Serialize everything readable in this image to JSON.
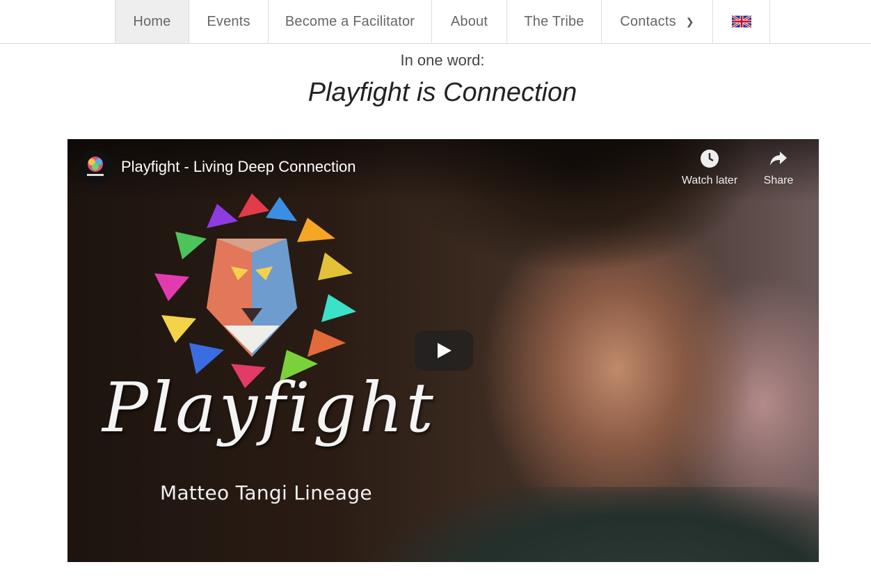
{
  "nav": {
    "items": [
      {
        "label": "Home",
        "active": true
      },
      {
        "label": "Events"
      },
      {
        "label": "Become a Facilitator"
      },
      {
        "label": "About"
      },
      {
        "label": "The Tribe"
      },
      {
        "label": "Contacts",
        "has_dropdown": true
      }
    ],
    "language_icon": "uk-flag-icon"
  },
  "hero": {
    "subtitle": "In one word:",
    "title": "Playfight is Connection"
  },
  "video": {
    "title": "Playfight - Living Deep Connection",
    "watch_later_label": "Watch later",
    "share_label": "Share",
    "overlay_script": "Playfight",
    "overlay_caption": "Matteo Tangi Lineage",
    "play_icon": "play-icon",
    "colors": {
      "play_button_bg": "#212121"
    }
  }
}
